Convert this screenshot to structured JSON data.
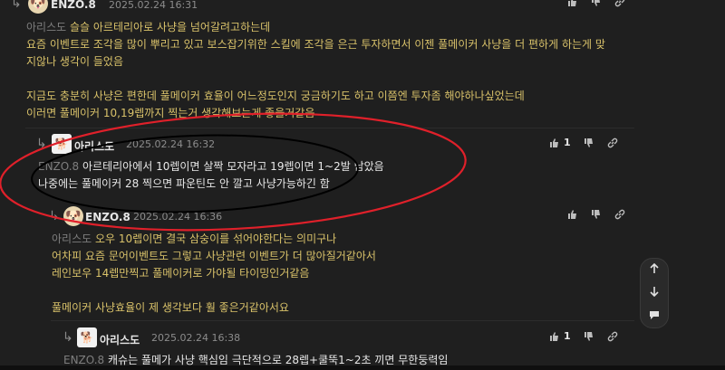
{
  "comments": [
    {
      "author": "ENZO.8",
      "date": "2025.02.24 16:31",
      "mention": "아리스도",
      "lines": [
        "슬슬 아르테리아로 사냥을 넘어갈려고하는데",
        "요즘 이벤트로 조각을 많이 뿌리고 있고 보스잡기위한 스킬에 조각을 은근 투자하면서 이젠 풀메이커 사냥을 더 편하게 하는게 맞",
        "지않나 생각이 들었음",
        "",
        "지금도 충분히 사냥은 편한데 풀메이커 효율이 어느정도인지 궁금하기도 하고 이쯤엔 투자좀 해야하나싶었는데",
        "이러면 풀메이커 10,19렙까지 찍는거 생각해보는게 좋을거같음"
      ]
    },
    {
      "author": "아리스도",
      "date": "2025.02.24 16:32",
      "likes": "1",
      "mention": "ENZO.8",
      "lines": [
        "아르테리아에서 10렙이면 살짝 모자라고 19렙이면 1~2발 남았음",
        "나중에는 풀메이커 28 찍으면 파운틴도 안 깔고 사냥가능하긴 함"
      ]
    },
    {
      "author": "ENZO.8",
      "date": "2025.02.24 16:36",
      "mention": "아리스도",
      "lines": [
        "오우 10렙이면 결국 삼숭이를 섞어야한다는 의미구나",
        "어차피 요즘 문어이벤트도 그렇고 사냥관련 이벤트가 더 많아질거같아서",
        "레인보우 14렙만찍고 풀메이커로 가야될 타이밍인거같음",
        "",
        "풀메이커 사냥효율이 제 생각보다 훨 좋은거같아서요"
      ]
    },
    {
      "author": "아리스도",
      "date": "2025.02.24 16:38",
      "likes": "1",
      "mention": "ENZO.8",
      "lines": [
        "캐슈는 풀메가 사냥 핵심임 극단적으로 28렙+쿨뚝1~2초 끼면 무한둥력임"
      ]
    }
  ],
  "colors": {
    "comment_text": "#d9c26a",
    "reply_text": "#e8e8e8",
    "red_annotation": "#e0202a",
    "black_annotation": "#000000"
  }
}
